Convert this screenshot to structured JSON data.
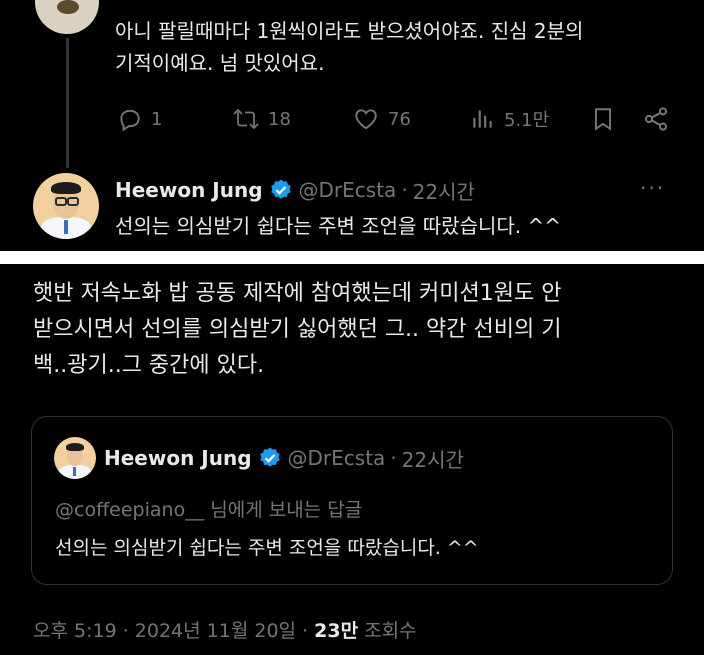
{
  "top_tweet": {
    "text_lines": [
      "아니 팔릴때마다 1원씩이라도 받으셨어야죠. 진심 2분의",
      "기적이예요. 넘 맛있어요."
    ],
    "actions": {
      "replies": "1",
      "reposts": "18",
      "likes": "76",
      "views": "5.1만"
    }
  },
  "reply_tweet": {
    "author_name": "Heewon Jung",
    "author_handle": "@DrEcsta",
    "separator": "·",
    "time": "22시간",
    "text": "선의는 의심받기 쉽다는 주변 조언을 따랐습니다. ^^",
    "more": "···"
  },
  "main_tweet": {
    "text_lines": [
      "햇반 저속노화 밥 공동 제작에 참여했는데 커미션1원도 안",
      "받으시면서 선의를 의심받기 싫어했던 그.. 약간 선비의 기",
      "백..광기..그 중간에 있다."
    ],
    "quote": {
      "author_name": "Heewon Jung",
      "author_handle": "@DrEcsta",
      "separator": "·",
      "time": "22시간",
      "replying_to": "@coffeepiano__ 님에게 보내는 답글",
      "text": "선의는 의심받기 쉽다는 주변 조언을 따랐습니다. ^^"
    },
    "meta": {
      "timestamp": "오후 5:19 · 2024년 11월 20일 · ",
      "views_count": "23만",
      "views_label": " 조회수"
    }
  },
  "colors": {
    "background": "#000000",
    "text": "#e7e9ea",
    "muted": "#71767b",
    "verified": "#1d9bf0",
    "border": "#2f3336"
  },
  "icons": [
    "reply-icon",
    "repost-icon",
    "like-icon",
    "views-icon",
    "bookmark-icon",
    "share-icon",
    "verified-badge-icon",
    "more-icon"
  ]
}
